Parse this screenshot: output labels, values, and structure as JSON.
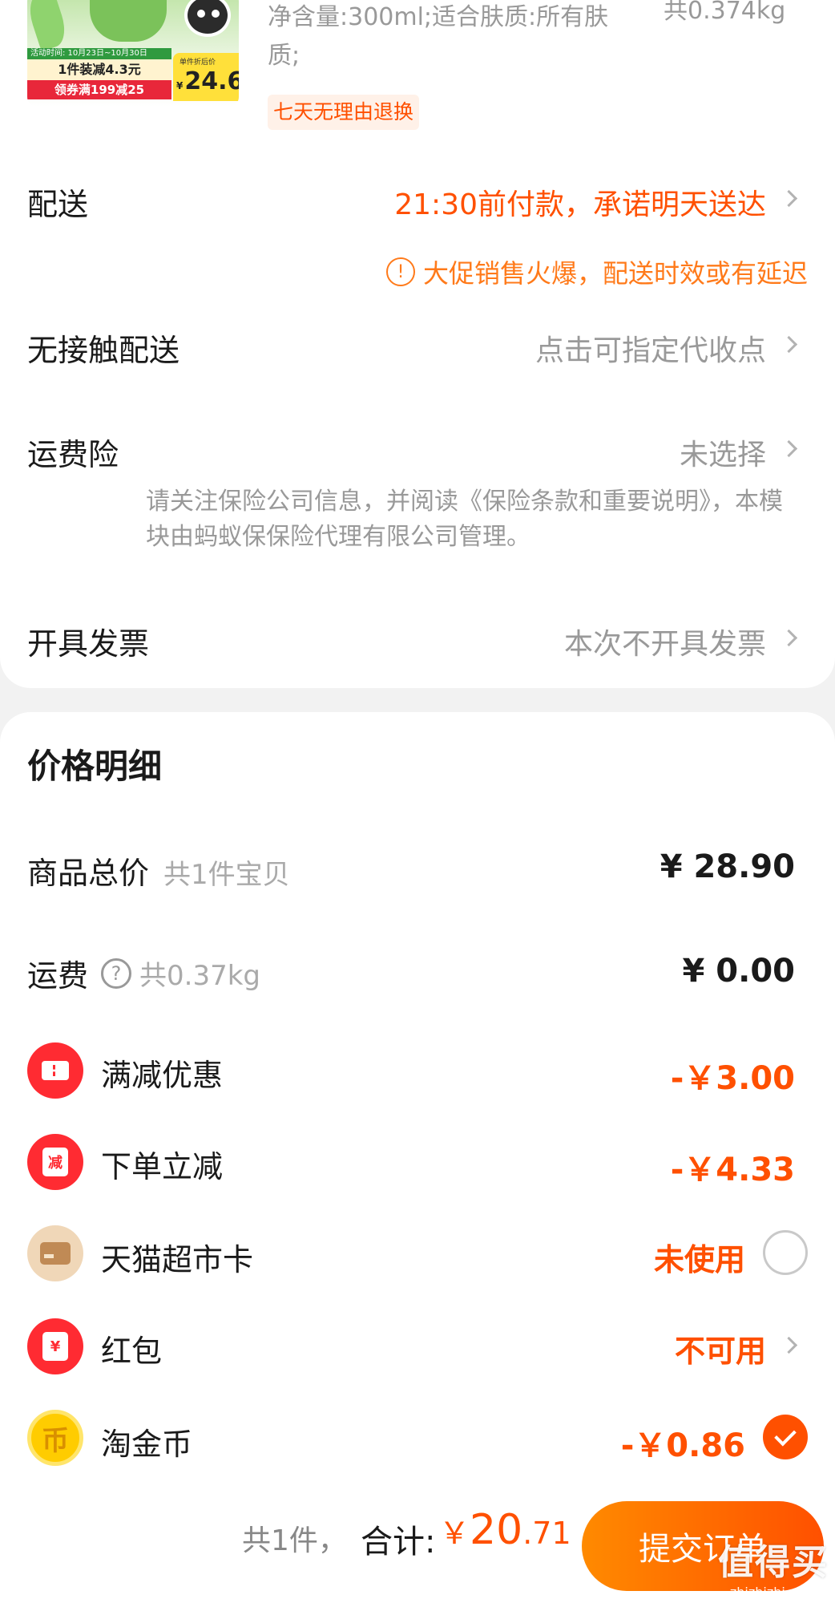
{
  "product": {
    "thumb_badge_activity": "活动时间: 10月23日~10月30日",
    "thumb_badge_offer": "1件装减4.3元",
    "thumb_badge_coupon": "领券满199减25",
    "thumb_price_label": "单件折后价",
    "thumb_price_symbol": "¥",
    "thumb_price_value": "24.6",
    "spec": "净含量:300ml;适合肤质:所有肤质;",
    "weight": "共0.374kg",
    "return_tag": "七天无理由退换"
  },
  "delivery": {
    "label": "配送",
    "value": "21:30前付款，承诺明天送达",
    "notice_icon": "!",
    "notice": "大促销售火爆，配送时效或有延迟"
  },
  "contactless": {
    "label": "无接触配送",
    "value": "点击可指定代收点"
  },
  "shipping_insurance": {
    "label": "运费险",
    "value": "未选择",
    "note": "请关注保险公司信息，并阅读《保险条款和重要说明》，本模块由蚂蚁保保险代理有限公司管理。"
  },
  "invoice": {
    "label": "开具发票",
    "value": "本次不开具发票"
  },
  "price_detail": {
    "title": "价格明细",
    "goods_total": {
      "label": "商品总价",
      "sub": "共1件宝贝",
      "amount": "¥ 28.90"
    },
    "shipping": {
      "label": "运费",
      "help_icon": "?",
      "sub": "共0.37kg",
      "amount": "¥ 0.00"
    },
    "items": [
      {
        "icon": "ticket-icon",
        "label": "满减优惠",
        "amount": "-￥3.00"
      },
      {
        "icon": "instant-discount-icon",
        "icon_text": "减",
        "label": "下单立减",
        "amount": "-￥4.33"
      },
      {
        "icon": "supermarket-card-icon",
        "label": "天猫超市卡",
        "status": "未使用"
      },
      {
        "icon": "red-packet-icon",
        "icon_text": "¥",
        "label": "红包",
        "status": "不可用"
      },
      {
        "icon": "gold-coin-icon",
        "icon_text": "币",
        "label": "淘金币",
        "amount": "-￥0.86"
      }
    ]
  },
  "footer": {
    "count": "共1件，",
    "total_label": "合计:",
    "total_symbol": "￥",
    "total_int": "20",
    "total_dec": ".71",
    "submit_label": "提交订单",
    "watermark": "值得买",
    "watermark_url": "zhizhizhi.com"
  },
  "colors": {
    "accent": "#ff5000",
    "notice": "#ff7a1a",
    "muted": "#999999"
  }
}
